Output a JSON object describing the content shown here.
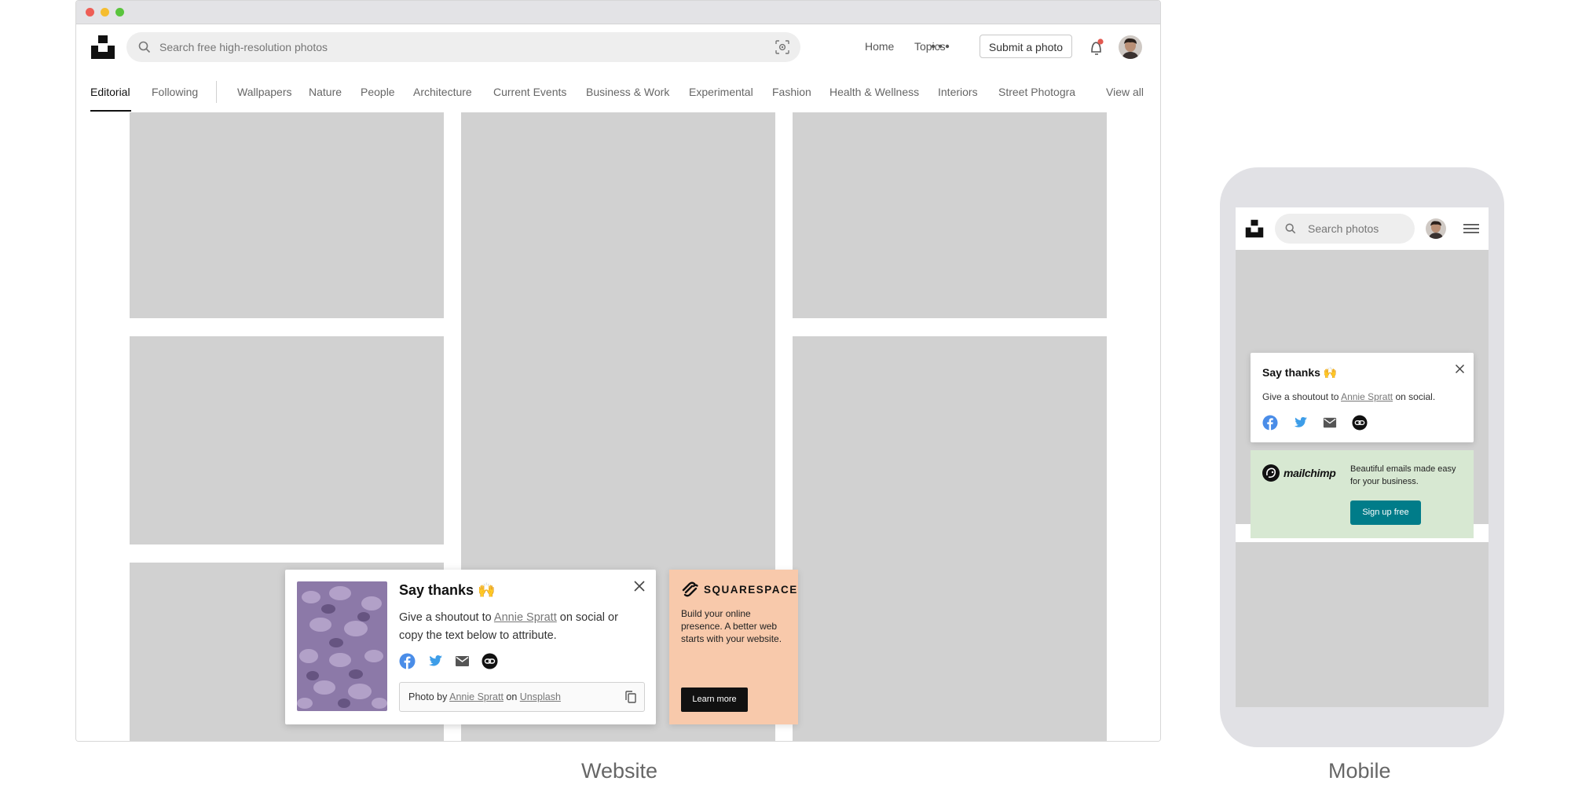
{
  "website": {
    "search_placeholder": "Search free high-resolution photos",
    "nav": {
      "home": "Home",
      "topics": "Topics",
      "submit": "Submit a photo"
    },
    "categories": [
      "Editorial",
      "Following",
      "Wallpapers",
      "Nature",
      "People",
      "Architecture",
      "Current Events",
      "Business & Work",
      "Experimental",
      "Fashion",
      "Health & Wellness",
      "Interiors",
      "Street Photogra",
      "View all"
    ],
    "active_category": "Editorial",
    "thanks": {
      "title": "Say thanks 🙌",
      "desc_pre": "Give a shoutout to ",
      "author": "Annie Spratt",
      "desc_post": " on social or copy the text below to attribute.",
      "attr_pre": "Photo by ",
      "attr_mid": " on ",
      "attr_site": "Unsplash"
    },
    "ad": {
      "brand": "SQUARESPACE",
      "text": "Build your online presence. A better web starts with your website.",
      "button": "Learn more"
    },
    "caption": "Website"
  },
  "mobile": {
    "search_placeholder": "Search photos",
    "thanks": {
      "title": "Say thanks 🙌",
      "desc_pre": "Give a shoutout to ",
      "author": "Annie Spratt",
      "desc_post": " on social."
    },
    "ad": {
      "brand": "mailchimp",
      "text": "Beautiful emails made easy for your business.",
      "button": "Sign up free"
    },
    "caption": "Mobile"
  },
  "colors": {
    "facebook": "#4a8de8",
    "twitter": "#3d9de8",
    "squarespace_bg": "#f8c9ab",
    "mailchimp_bg": "#d7e8d2",
    "mailchimp_button": "#007c89",
    "placeholder": "#d1d1d1"
  },
  "icons": [
    "search-icon",
    "visual-search-icon",
    "more-dots-icon",
    "bell-icon",
    "close-icon",
    "facebook-icon",
    "twitter-icon",
    "email-icon",
    "link-icon",
    "copy-icon",
    "menu-icon"
  ]
}
